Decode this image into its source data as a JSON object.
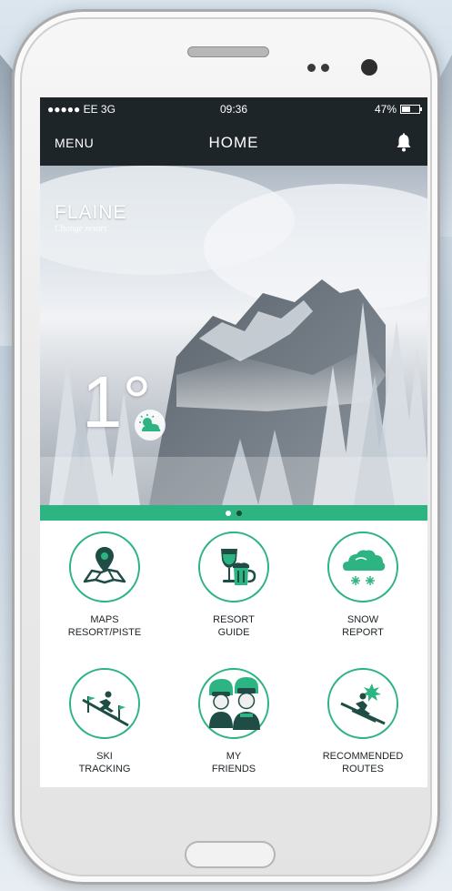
{
  "status_bar": {
    "carrier": "●●●●● EE  3G",
    "time": "09:36",
    "battery_percent": "47%"
  },
  "nav": {
    "menu_label": "MENU",
    "title": "HOME",
    "bell_icon": "bell-icon"
  },
  "hero": {
    "resort_name": "FLAINE",
    "change_resort_label": "Change resort",
    "temperature": "1°",
    "weather_icon": "sun-cloud-icon"
  },
  "pager": {
    "pages": 2,
    "active_index": 0
  },
  "tiles": [
    {
      "label": "MAPS\nRESORT/PISTE",
      "icon": "map-pin-icon"
    },
    {
      "label": "RESORT\nGUIDE",
      "icon": "drinks-icon"
    },
    {
      "label": "SNOW\nREPORT",
      "icon": "snow-cloud-icon"
    },
    {
      "label": "SKI\nTRACKING",
      "icon": "skier-tracking-icon"
    },
    {
      "label": "MY\nFRIENDS",
      "icon": "friends-icon"
    },
    {
      "label": "RECOMMENDED\nROUTES",
      "icon": "skier-routes-icon"
    }
  ],
  "colors": {
    "accent": "#2cb482",
    "navbar": "#1e2529",
    "icon_dark": "#1f4d45"
  }
}
